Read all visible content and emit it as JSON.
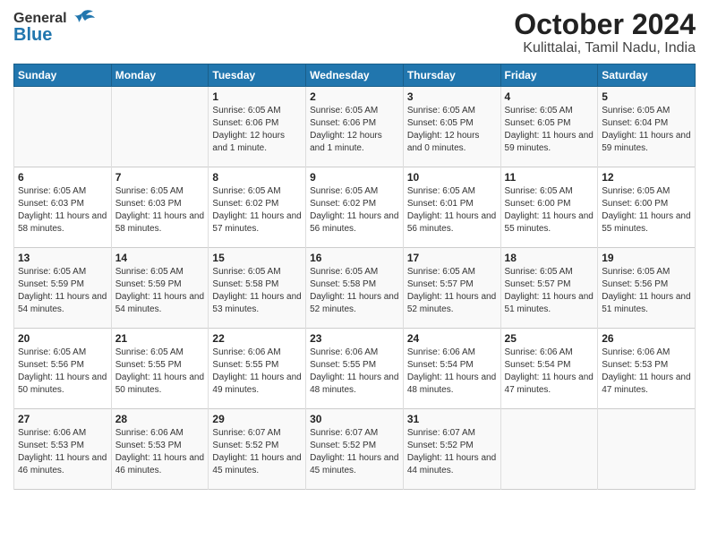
{
  "logo": {
    "general": "General",
    "blue": "Blue"
  },
  "title": "October 2024",
  "subtitle": "Kulittalai, Tamil Nadu, India",
  "columns": [
    "Sunday",
    "Monday",
    "Tuesday",
    "Wednesday",
    "Thursday",
    "Friday",
    "Saturday"
  ],
  "rows": [
    [
      {
        "day": "",
        "info": ""
      },
      {
        "day": "",
        "info": ""
      },
      {
        "day": "1",
        "info": "Sunrise: 6:05 AM\nSunset: 6:06 PM\nDaylight: 12 hours and 1 minute."
      },
      {
        "day": "2",
        "info": "Sunrise: 6:05 AM\nSunset: 6:06 PM\nDaylight: 12 hours and 1 minute."
      },
      {
        "day": "3",
        "info": "Sunrise: 6:05 AM\nSunset: 6:05 PM\nDaylight: 12 hours and 0 minutes."
      },
      {
        "day": "4",
        "info": "Sunrise: 6:05 AM\nSunset: 6:05 PM\nDaylight: 11 hours and 59 minutes."
      },
      {
        "day": "5",
        "info": "Sunrise: 6:05 AM\nSunset: 6:04 PM\nDaylight: 11 hours and 59 minutes."
      }
    ],
    [
      {
        "day": "6",
        "info": "Sunrise: 6:05 AM\nSunset: 6:03 PM\nDaylight: 11 hours and 58 minutes."
      },
      {
        "day": "7",
        "info": "Sunrise: 6:05 AM\nSunset: 6:03 PM\nDaylight: 11 hours and 58 minutes."
      },
      {
        "day": "8",
        "info": "Sunrise: 6:05 AM\nSunset: 6:02 PM\nDaylight: 11 hours and 57 minutes."
      },
      {
        "day": "9",
        "info": "Sunrise: 6:05 AM\nSunset: 6:02 PM\nDaylight: 11 hours and 56 minutes."
      },
      {
        "day": "10",
        "info": "Sunrise: 6:05 AM\nSunset: 6:01 PM\nDaylight: 11 hours and 56 minutes."
      },
      {
        "day": "11",
        "info": "Sunrise: 6:05 AM\nSunset: 6:00 PM\nDaylight: 11 hours and 55 minutes."
      },
      {
        "day": "12",
        "info": "Sunrise: 6:05 AM\nSunset: 6:00 PM\nDaylight: 11 hours and 55 minutes."
      }
    ],
    [
      {
        "day": "13",
        "info": "Sunrise: 6:05 AM\nSunset: 5:59 PM\nDaylight: 11 hours and 54 minutes."
      },
      {
        "day": "14",
        "info": "Sunrise: 6:05 AM\nSunset: 5:59 PM\nDaylight: 11 hours and 54 minutes."
      },
      {
        "day": "15",
        "info": "Sunrise: 6:05 AM\nSunset: 5:58 PM\nDaylight: 11 hours and 53 minutes."
      },
      {
        "day": "16",
        "info": "Sunrise: 6:05 AM\nSunset: 5:58 PM\nDaylight: 11 hours and 52 minutes."
      },
      {
        "day": "17",
        "info": "Sunrise: 6:05 AM\nSunset: 5:57 PM\nDaylight: 11 hours and 52 minutes."
      },
      {
        "day": "18",
        "info": "Sunrise: 6:05 AM\nSunset: 5:57 PM\nDaylight: 11 hours and 51 minutes."
      },
      {
        "day": "19",
        "info": "Sunrise: 6:05 AM\nSunset: 5:56 PM\nDaylight: 11 hours and 51 minutes."
      }
    ],
    [
      {
        "day": "20",
        "info": "Sunrise: 6:05 AM\nSunset: 5:56 PM\nDaylight: 11 hours and 50 minutes."
      },
      {
        "day": "21",
        "info": "Sunrise: 6:05 AM\nSunset: 5:55 PM\nDaylight: 11 hours and 50 minutes."
      },
      {
        "day": "22",
        "info": "Sunrise: 6:06 AM\nSunset: 5:55 PM\nDaylight: 11 hours and 49 minutes."
      },
      {
        "day": "23",
        "info": "Sunrise: 6:06 AM\nSunset: 5:55 PM\nDaylight: 11 hours and 48 minutes."
      },
      {
        "day": "24",
        "info": "Sunrise: 6:06 AM\nSunset: 5:54 PM\nDaylight: 11 hours and 48 minutes."
      },
      {
        "day": "25",
        "info": "Sunrise: 6:06 AM\nSunset: 5:54 PM\nDaylight: 11 hours and 47 minutes."
      },
      {
        "day": "26",
        "info": "Sunrise: 6:06 AM\nSunset: 5:53 PM\nDaylight: 11 hours and 47 minutes."
      }
    ],
    [
      {
        "day": "27",
        "info": "Sunrise: 6:06 AM\nSunset: 5:53 PM\nDaylight: 11 hours and 46 minutes."
      },
      {
        "day": "28",
        "info": "Sunrise: 6:06 AM\nSunset: 5:53 PM\nDaylight: 11 hours and 46 minutes."
      },
      {
        "day": "29",
        "info": "Sunrise: 6:07 AM\nSunset: 5:52 PM\nDaylight: 11 hours and 45 minutes."
      },
      {
        "day": "30",
        "info": "Sunrise: 6:07 AM\nSunset: 5:52 PM\nDaylight: 11 hours and 45 minutes."
      },
      {
        "day": "31",
        "info": "Sunrise: 6:07 AM\nSunset: 5:52 PM\nDaylight: 11 hours and 44 minutes."
      },
      {
        "day": "",
        "info": ""
      },
      {
        "day": "",
        "info": ""
      }
    ]
  ]
}
